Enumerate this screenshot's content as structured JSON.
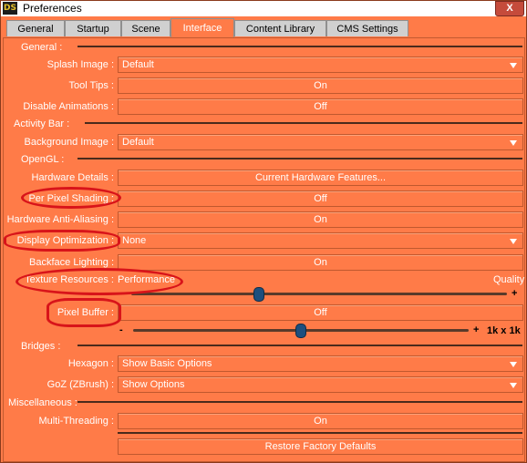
{
  "window": {
    "app_icon": "DS",
    "title": "Preferences",
    "close_label": "X"
  },
  "tabs": [
    "General",
    "Startup",
    "Scene",
    "Interface",
    "Content Library",
    "CMS Settings"
  ],
  "active_tab": "Interface",
  "sections": {
    "general": "General :",
    "activity_bar": "Activity Bar :",
    "opengl": "OpenGL :",
    "bridges": "Bridges :",
    "misc": "Miscellaneous :"
  },
  "general": {
    "splash_image_label": "Splash Image :",
    "splash_image_value": "Default",
    "tool_tips_label": "Tool Tips :",
    "tool_tips_value": "On",
    "disable_animations_label": "Disable Animations :",
    "disable_animations_value": "Off"
  },
  "activity_bar": {
    "background_image_label": "Background Image :",
    "background_image_value": "Default"
  },
  "opengl": {
    "hardware_details_label": "Hardware Details :",
    "hardware_details_button": "Current Hardware Features...",
    "per_pixel_shading_label": "Per Pixel Shading :",
    "per_pixel_shading_value": "Off",
    "anti_aliasing_label": "Hardware Anti-Aliasing :",
    "anti_aliasing_value": "On",
    "display_optimization_label": "Display Optimization :",
    "display_optimization_value": "None",
    "backface_lighting_label": "Backface Lighting :",
    "backface_lighting_value": "On",
    "texture_resources_label": "Texture Resources :",
    "texture_resources_value": "Performance",
    "texture_resources_max": "Quality",
    "texture_slider_minus": "-",
    "texture_slider_plus": "+",
    "texture_slider_level": 0.34,
    "pixel_buffer_label": "Pixel Buffer :",
    "pixel_buffer_value": "Off",
    "pixel_buffer_slider_minus": "-",
    "pixel_buffer_slider_plus": "+",
    "pixel_buffer_size": "1k x 1k",
    "pixel_buffer_slider_level": 0.5
  },
  "bridges": {
    "hexagon_label": "Hexagon :",
    "hexagon_value": "Show Basic Options",
    "goz_label": "GoZ (ZBrush) :",
    "goz_value": "Show Options"
  },
  "misc": {
    "multithreading_label": "Multi-Threading :",
    "multithreading_value": "On",
    "restore_button": "Restore Factory Defaults"
  },
  "colors": {
    "panel": "#ff7b48",
    "annotation": "#d8141a",
    "slider_thumb": "#1d4f7e"
  }
}
